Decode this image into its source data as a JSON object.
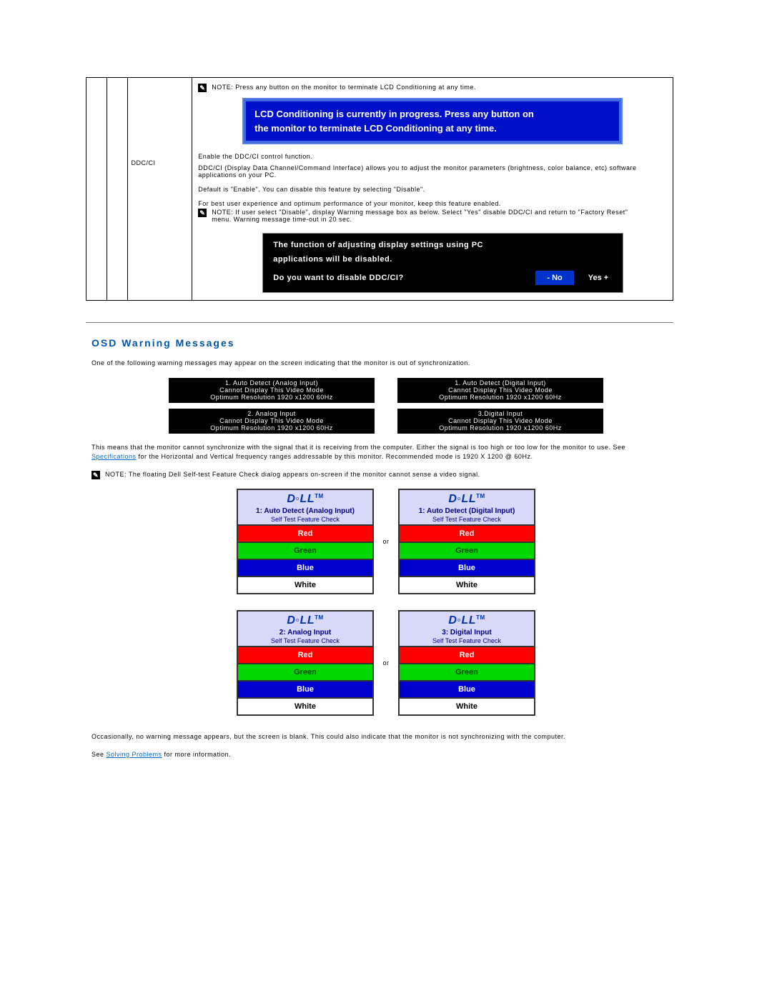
{
  "settings": {
    "note1": "NOTE: Press any button on the monitor to terminate LCD Conditioning at any time.",
    "lcd_banner_l1": "LCD Conditioning is currently in progress.  Press any button on",
    "lcd_banner_l2": "the monitor to terminate LCD Conditioning at any time.",
    "row_label": "DDC/CI",
    "ddc_p1": "Enable the DDC/CI control function.",
    "ddc_p2": "DDC/CI (Display Data Channel/Command Interface) allows you to adjust the monitor parameters (brightness, color balance, etc) software applications on your PC.",
    "ddc_p3": "Default is \"Enable\". You can disable this feature by selecting \"Disable\".",
    "ddc_p4": "For best user experience and optimum performance of your monitor, keep this feature enabled.",
    "ddc_note": "NOTE: If user select \"Disable\", display Warning message box as below. Select \"Yes\" disable DDC/CI and return to \"Factory Reset\" menu. Warning message time-out in 20 sec.",
    "dlg_l1": "The function of adjusting display settings using PC",
    "dlg_l2": "applications will be disabled.",
    "dlg_q": "Do you want to disable DDC/CI?",
    "dlg_no": "- No",
    "dlg_yes": "Yes +"
  },
  "osd": {
    "title": "OSD Warning Messages",
    "intro": "One of the following warning messages may appear on the screen indicating that the monitor is out of synchronization.",
    "boxes": [
      {
        "l1": "1. Auto Detect (Analog Input)",
        "l2": "Cannot Display This Video Mode",
        "l3": "Optimum Resolution 1920 x1200 60Hz"
      },
      {
        "l1": "1. Auto Detect  (Digital Input)",
        "l2": "Cannot Display This Video Mode",
        "l3": "Optimum Resolution 1920 x1200 60Hz"
      },
      {
        "l1": "2. Analog Input",
        "l2": "Cannot Display This Video Mode",
        "l3": "Optimum Resolution 1920 x1200 60Hz"
      },
      {
        "l1": "3.Digital Input",
        "l2": "Cannot Display This Video Mode",
        "l3": "Optimum Resolution 1920 x1200 60Hz"
      }
    ],
    "explain_pre": "This means that the monitor cannot synchronize with the signal that it is receiving from the computer. Either the signal is too high or too low for the monitor to use.  See ",
    "explain_link": "Specifications",
    "explain_post": " for the Horizontal and Vertical frequency ranges addressable by this monitor. Recommended mode is 1920 X 1200 @ 60Hz.",
    "float_note": "NOTE: The floating Dell Self-test Feature Check dialog appears on-screen if the monitor cannot sense a video signal.",
    "or": "or",
    "stc_sub": "Self Test  Feature Check",
    "stc_modes": [
      "1: Auto Detect (Analog Input)",
      "1: Auto Detect (Digital Input)",
      "2: Analog Input",
      "3: Digital Input"
    ],
    "bars": {
      "red": "Red",
      "green": "Green",
      "blue": "Blue",
      "white": "White"
    },
    "occasional": "Occasionally, no warning message appears, but the screen is blank. This could also indicate that the monitor is not synchronizing with the computer.",
    "see_pre": "See ",
    "see_link": "Solving Problems",
    "see_post": " for more information."
  }
}
